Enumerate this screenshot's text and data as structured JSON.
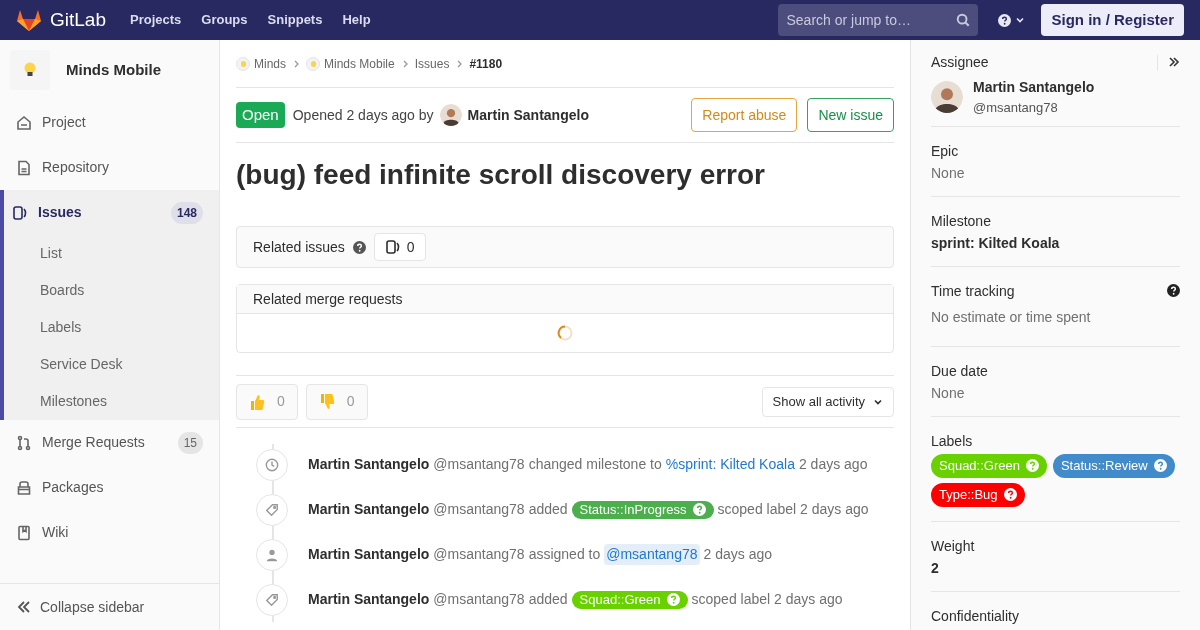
{
  "header": {
    "brand": "GitLab",
    "nav": [
      "Projects",
      "Groups",
      "Snippets",
      "Help"
    ],
    "search": {
      "placeholder": "Search or jump to…"
    },
    "signin": "Sign in / Register"
  },
  "sidebar": {
    "project": "Minds Mobile",
    "items": [
      {
        "kind": "home",
        "label": "Project",
        "selected": false
      },
      {
        "kind": "doc",
        "label": "Repository",
        "selected": false
      },
      {
        "kind": "issues",
        "label": "Issues",
        "selected": true,
        "count": "148",
        "children": [
          {
            "label": "List",
            "selected": false
          },
          {
            "label": "Boards",
            "selected": false
          },
          {
            "label": "Labels",
            "selected": false
          },
          {
            "label": "Service Desk",
            "selected": false
          },
          {
            "label": "Milestones",
            "selected": false
          }
        ]
      },
      {
        "kind": "merge",
        "label": "Merge Requests",
        "selected": false,
        "count": "15"
      },
      {
        "kind": "package",
        "label": "Packages",
        "selected": false
      },
      {
        "kind": "book",
        "label": "Wiki",
        "selected": false
      }
    ],
    "collapse": "Collapse sidebar"
  },
  "breadcrumbs": [
    {
      "label": "Minds",
      "avatar": true
    },
    {
      "label": "Minds Mobile",
      "avatar": true
    },
    {
      "label": "Issues",
      "avatar": false
    },
    {
      "label": "#1180",
      "avatar": false,
      "current": true
    }
  ],
  "issue": {
    "status": "Open",
    "opened": "Opened 2 days ago by",
    "author": "Martin Santangelo",
    "report": "Report abuse",
    "new": "New issue",
    "title": "(bug) feed infinite scroll discovery error"
  },
  "related_issues": {
    "title": "Related issues",
    "count": "0"
  },
  "related_mrs": {
    "title": "Related merge requests"
  },
  "awards": [
    {
      "kind": "up",
      "count": "0"
    },
    {
      "kind": "down",
      "count": "0"
    }
  ],
  "activity_filter": "Show all activity",
  "activity": [
    {
      "kind": "milestone",
      "author": "Martin Santangelo",
      "username": "@msantang78",
      "parts": [
        {
          "kind": "text",
          "text": "changed milestone to"
        },
        {
          "kind": "link",
          "text": "%sprint: Kilted Koala"
        },
        {
          "kind": "text",
          "text": "2 days ago"
        }
      ]
    },
    {
      "kind": "label",
      "author": "Martin Santangelo",
      "username": "@msantang78",
      "parts": [
        {
          "kind": "text",
          "text": "added"
        },
        {
          "kind": "label",
          "text": "Status::InProgress",
          "color": "#4cae4c"
        },
        {
          "kind": "text",
          "text": "scoped label 2 days ago"
        }
      ]
    },
    {
      "kind": "assignee",
      "author": "Martin Santangelo",
      "username": "@msantang78",
      "parts": [
        {
          "kind": "text",
          "text": "assigned to"
        },
        {
          "kind": "mention",
          "text": "@msantang78"
        },
        {
          "kind": "text",
          "text": "2 days ago"
        }
      ]
    },
    {
      "kind": "label",
      "author": "Martin Santangelo",
      "username": "@msantang78",
      "parts": [
        {
          "kind": "text",
          "text": "added"
        },
        {
          "kind": "label",
          "text": "Squad::Green",
          "color": "#69d100"
        },
        {
          "kind": "text",
          "text": "scoped label 2 days ago"
        }
      ]
    }
  ],
  "right": {
    "assignee": {
      "title": "Assignee",
      "name": "Martin Santangelo",
      "username": "@msantang78"
    },
    "sections": [
      {
        "kind": "plain",
        "title": "Epic",
        "value": "None"
      },
      {
        "kind": "bold",
        "title": "Milestone",
        "value": "sprint: Kilted Koala"
      },
      {
        "kind": "help",
        "title": "Time tracking",
        "value": "No estimate or time spent"
      },
      {
        "kind": "plain",
        "title": "Due date",
        "value": "None"
      },
      {
        "kind": "labels",
        "title": "Labels",
        "labels": [
          {
            "text": "Squad::Green",
            "color": "#69d100"
          },
          {
            "text": "Status::Review",
            "color": "#428bca"
          },
          {
            "text": "Type::Bug",
            "color": "#ff0000"
          }
        ]
      },
      {
        "kind": "bold",
        "title": "Weight",
        "value": "2"
      },
      {
        "kind": "heading",
        "title": "Confidentiality"
      }
    ]
  }
}
